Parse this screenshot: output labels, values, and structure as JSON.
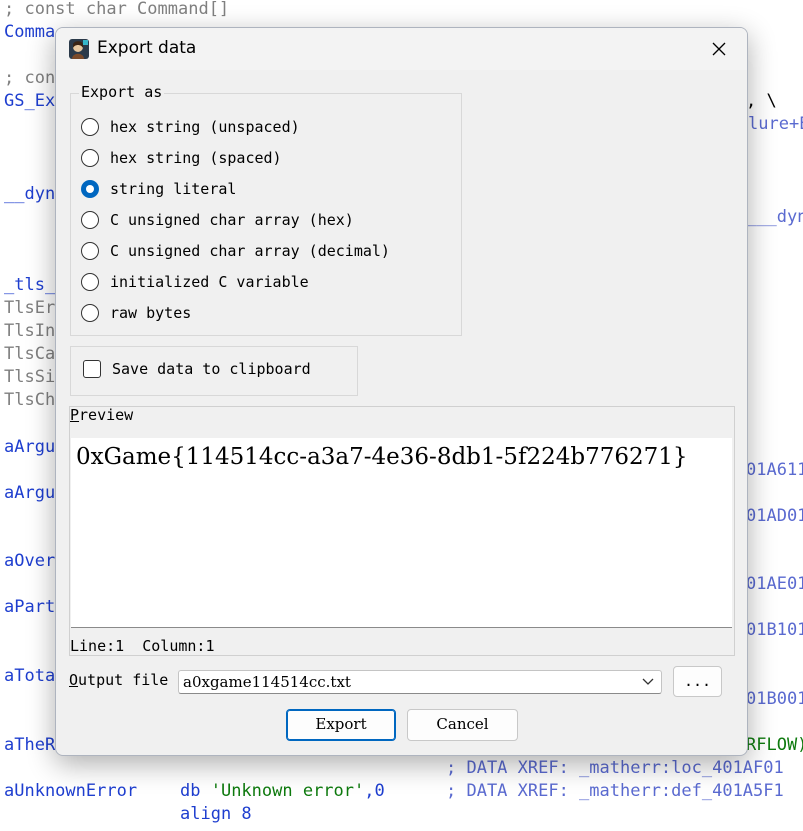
{
  "background_listing": {
    "lines": [
      {
        "text": "; const char Command[]",
        "cls": "grey"
      },
      {
        "text": "Comma",
        "cls": "blue"
      },
      {
        "text": "; con",
        "cls": "grey"
      },
      {
        "text": "GS_Ex",
        "cls": "blue"
      },
      {
        "text": ", \\",
        "cls": "black"
      },
      {
        "text": "lure+E",
        "cls": "xref"
      },
      {
        "text": "__dyn",
        "cls": "blue"
      },
      {
        "text": "___dyn",
        "cls": "xref"
      },
      {
        "text": "_tls_",
        "cls": "blue"
      },
      {
        "text": "TlsEr",
        "cls": "grey"
      },
      {
        "text": "TlsIn",
        "cls": "grey"
      },
      {
        "text": "TlsCa",
        "cls": "grey"
      },
      {
        "text": "TlsSi",
        "cls": "grey"
      },
      {
        "text": "TlsCh",
        "cls": "grey"
      },
      {
        "text": "aArgu",
        "cls": "blue"
      },
      {
        "text": "01A611",
        "cls": "xref"
      },
      {
        "text": "aArgu",
        "cls": "blue"
      },
      {
        "text": "01AD01",
        "cls": "xref"
      },
      {
        "text": "aOver",
        "cls": "blue"
      },
      {
        "text": "01AE01",
        "cls": "xref"
      },
      {
        "text": "aPart",
        "cls": "blue"
      },
      {
        "text": "01B101",
        "cls": "xref"
      },
      {
        "text": "aTota",
        "cls": "blue"
      },
      {
        "text": "01B001",
        "cls": "xref"
      },
      {
        "text": "aTheR",
        "cls": "blue"
      },
      {
        "text": "RFLOW)",
        "cls": "green"
      },
      {
        "text": "; DATA XREF: _matherr:loc_401AF01",
        "cls": "xref"
      },
      {
        "text": "aUnknownError",
        "cls": "blue"
      },
      {
        "text": "db ",
        "cls": "blue"
      },
      {
        "text": "'Unknown error'",
        "cls": "green"
      },
      {
        "text": ",0",
        "cls": "blue"
      },
      {
        "text": "; DATA XREF: _matherr:def_401A5F1",
        "cls": "xref"
      },
      {
        "text": "align 8",
        "cls": "blue"
      }
    ]
  },
  "dialog": {
    "title": "Export data",
    "export_group": {
      "legend": "Export as",
      "options": [
        {
          "label": "hex string (unspaced)",
          "selected": false
        },
        {
          "label": "hex string (spaced)",
          "selected": false
        },
        {
          "label": "string literal",
          "selected": true
        },
        {
          "label": "C unsigned char array (hex)",
          "selected": false
        },
        {
          "label": "C unsigned char array (decimal)",
          "selected": false
        },
        {
          "label": "initialized C variable",
          "selected": false
        },
        {
          "label": "raw bytes",
          "selected": false
        }
      ]
    },
    "clipboard": {
      "label": "Save data to clipboard",
      "checked": false
    },
    "preview": {
      "label_first": "P",
      "label_rest": "review",
      "text": "0xGame{114514cc-a3a7-4e36-8db1-5f224b776271}",
      "status": "Line:1  Column:1"
    },
    "output": {
      "label_first": "O",
      "label_rest": "utput file",
      "value": "a0xgame114514cc.txt",
      "browse_label": "..."
    },
    "buttons": {
      "export": "Export",
      "cancel": "Cancel"
    },
    "colors": {
      "accent": "#0067c0",
      "dialog_bg": "#f0f0f0"
    }
  }
}
